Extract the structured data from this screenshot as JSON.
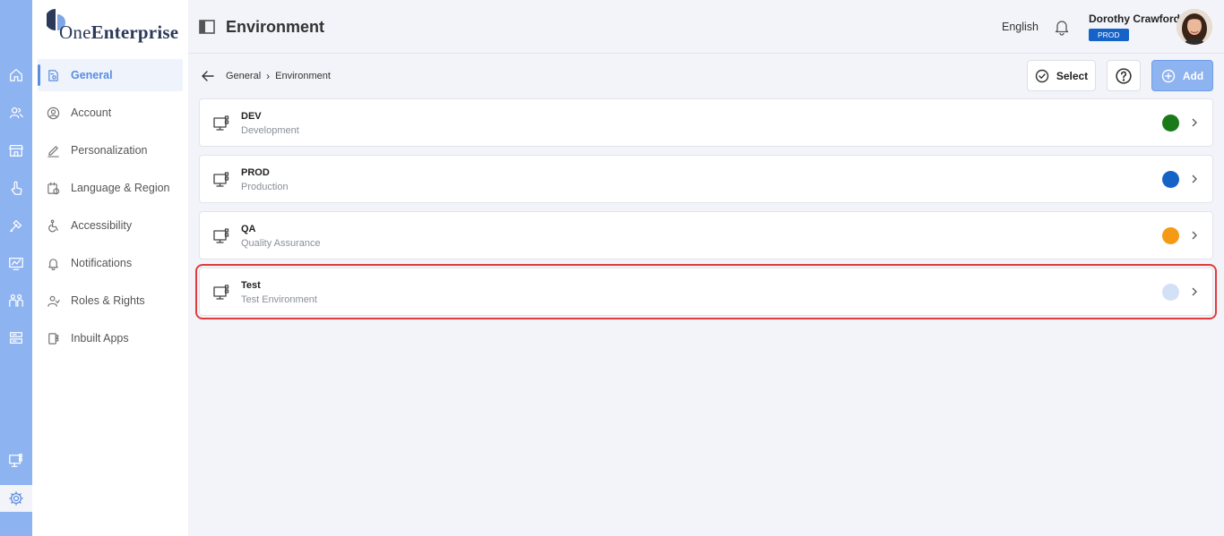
{
  "app": {
    "logo_prefix": "One",
    "logo_bold": "Enterprise"
  },
  "header": {
    "title": "Environment",
    "language": "English",
    "user_name": "Dorothy Crawford",
    "env_badge": "PROD"
  },
  "sidebar": {
    "items": [
      {
        "label": "General",
        "icon": "general-settings-icon",
        "active": true
      },
      {
        "label": "Account",
        "icon": "account-icon"
      },
      {
        "label": "Personalization",
        "icon": "pencil-icon"
      },
      {
        "label": "Language & Region",
        "icon": "language-region-icon"
      },
      {
        "label": "Accessibility",
        "icon": "accessibility-icon"
      },
      {
        "label": "Notifications",
        "icon": "notification-icon"
      },
      {
        "label": "Roles & Rights",
        "icon": "roles-icon"
      },
      {
        "label": "Inbuilt Apps",
        "icon": "apps-icon"
      }
    ]
  },
  "rail": {
    "icons": [
      "home-icon",
      "users-icon",
      "store-icon",
      "touch-icon",
      "tools-icon",
      "dashboard-icon",
      "team-icon",
      "server-icon",
      "environment-icon",
      "settings-icon"
    ]
  },
  "breadcrumb": {
    "parent": "General",
    "separator": "›",
    "current": "Environment"
  },
  "toolbar": {
    "select_label": "Select",
    "add_label": "Add"
  },
  "environments": [
    {
      "name": "DEV",
      "description": "Development",
      "color": "#1a7a1a"
    },
    {
      "name": "PROD",
      "description": "Production",
      "color": "#1663c7"
    },
    {
      "name": "QA",
      "description": "Quality Assurance",
      "color": "#f59a14"
    },
    {
      "name": "Test",
      "description": "Test Environment",
      "color": "#d3e1f7",
      "highlighted": true
    }
  ],
  "colors": {
    "accent": "#5a8de0",
    "rail": "#8db3f0",
    "highlight": "#e33b3b"
  }
}
